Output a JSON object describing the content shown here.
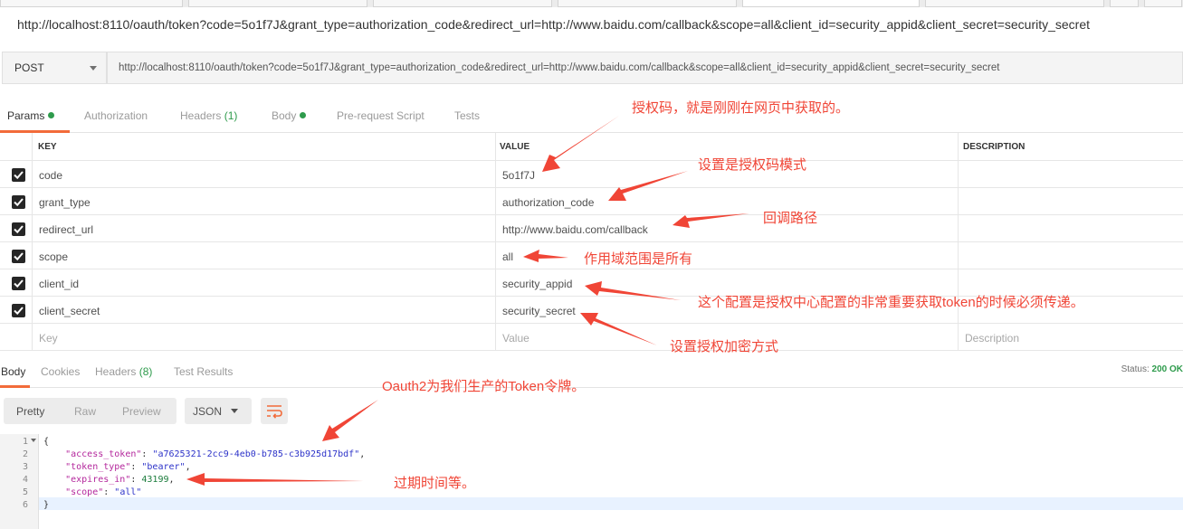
{
  "title_url": "http://localhost:8110/oauth/token?code=5o1f7J&grant_type=authorization_code&redirect_url=http://www.baidu.com/callback&scope=all&client_id=security_appid&client_secret=security_secret",
  "request": {
    "method": "POST",
    "url": "http://localhost:8110/oauth/token?code=5o1f7J&grant_type=authorization_code&redirect_url=http://www.baidu.com/callback&scope=all&client_id=security_appid&client_secret=security_secret"
  },
  "request_tabs": {
    "params": "Params",
    "authorization": "Authorization",
    "headers": "Headers",
    "headers_count": "(1)",
    "body": "Body",
    "prerequest": "Pre-request Script",
    "tests": "Tests"
  },
  "params_table": {
    "headers": {
      "key": "KEY",
      "value": "VALUE",
      "description": "DESCRIPTION"
    },
    "rows": [
      {
        "key": "code",
        "value": "5o1f7J"
      },
      {
        "key": "grant_type",
        "value": "authorization_code"
      },
      {
        "key": "redirect_url",
        "value": "http://www.baidu.com/callback"
      },
      {
        "key": "scope",
        "value": "all"
      },
      {
        "key": "client_id",
        "value": "security_appid"
      },
      {
        "key": "client_secret",
        "value": "security_secret"
      }
    ],
    "placeholder": {
      "key": "Key",
      "value": "Value",
      "description": "Description"
    }
  },
  "response_tabs": {
    "body": "Body",
    "cookies": "Cookies",
    "headers": "Headers",
    "headers_count": "(8)",
    "test_results": "Test Results"
  },
  "status": {
    "label": "Status:",
    "value": "200 OK"
  },
  "view_buttons": {
    "pretty": "Pretty",
    "raw": "Raw",
    "preview": "Preview"
  },
  "format_select": "JSON",
  "code_lines": {
    "l1": "{",
    "l2_key": "\"access_token\"",
    "l2_val": "\"a7625321-2cc9-4eb0-b785-c3b925d17bdf\"",
    "l3_key": "\"token_type\"",
    "l3_val": "\"bearer\"",
    "l4_key": "\"expires_in\"",
    "l4_val": "43199",
    "l5_key": "\"scope\"",
    "l5_val": "\"all\"",
    "l6": "}"
  },
  "line_numbers": [
    "1",
    "2",
    "3",
    "4",
    "5",
    "6"
  ],
  "annotations": {
    "code": "授权码，就是刚刚在网页中获取的。",
    "grant_type": "设置是授权码模式",
    "redirect": "回调路径",
    "scope": "作用域范围是所有",
    "client_id": "这个配置是授权中心配置的非常重要获取token的时候必须传递。",
    "client_secret": "设置授权加密方式",
    "token": "Oauth2为我们生产的Token令牌。",
    "expires": "过期时间等。"
  },
  "colors": {
    "accent": "#f26b3a",
    "green": "#2e9b4c",
    "annotation": "#f04536"
  }
}
